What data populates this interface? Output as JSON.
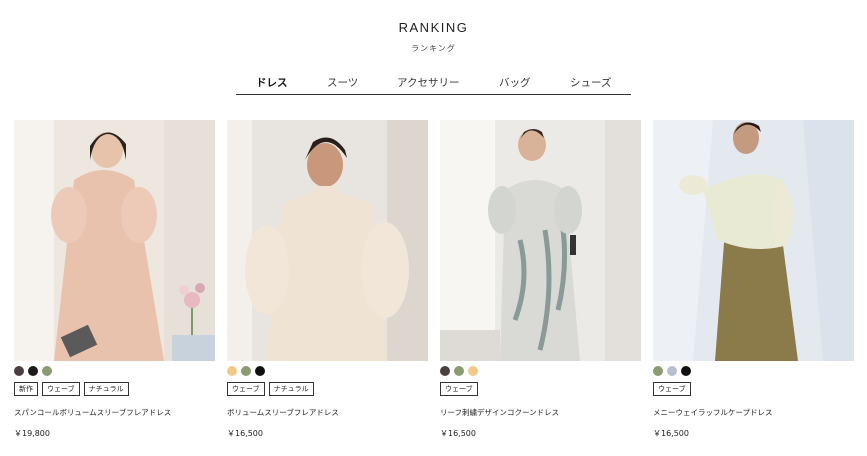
{
  "header": {
    "title": "RANKING",
    "subtitle": "ランキング"
  },
  "tabs": [
    {
      "label": "ドレス",
      "active": true
    },
    {
      "label": "スーツ",
      "active": false
    },
    {
      "label": "アクセサリー",
      "active": false
    },
    {
      "label": "バッグ",
      "active": false
    },
    {
      "label": "シューズ",
      "active": false
    }
  ],
  "products": [
    {
      "swatches": [
        "#4a3f3c",
        "#1a1a1a",
        "#8a9a72"
      ],
      "tags": [
        "新作",
        "ウェーブ",
        "ナチュラル"
      ],
      "name": "スパンコールボリュームスリーブフレアドレス",
      "price": "￥19,800"
    },
    {
      "swatches": [
        "#f2c98a",
        "#8a9a72",
        "#111111"
      ],
      "tags": [
        "ウェーブ",
        "ナチュラル"
      ],
      "name": "ボリュームスリーブフレアドレス",
      "price": "￥16,500"
    },
    {
      "swatches": [
        "#4a3f3c",
        "#8a9a72",
        "#f2c98a"
      ],
      "tags": [
        "ウェーブ"
      ],
      "name": "リーフ刺繍デザインコクーンドレス",
      "price": "￥16,500"
    },
    {
      "swatches": [
        "#8a9a72",
        "#b8bfd0",
        "#111111"
      ],
      "tags": [
        "ウェーブ"
      ],
      "name": "メニーウェイラッフルケープドレス",
      "price": "￥16,500"
    }
  ]
}
